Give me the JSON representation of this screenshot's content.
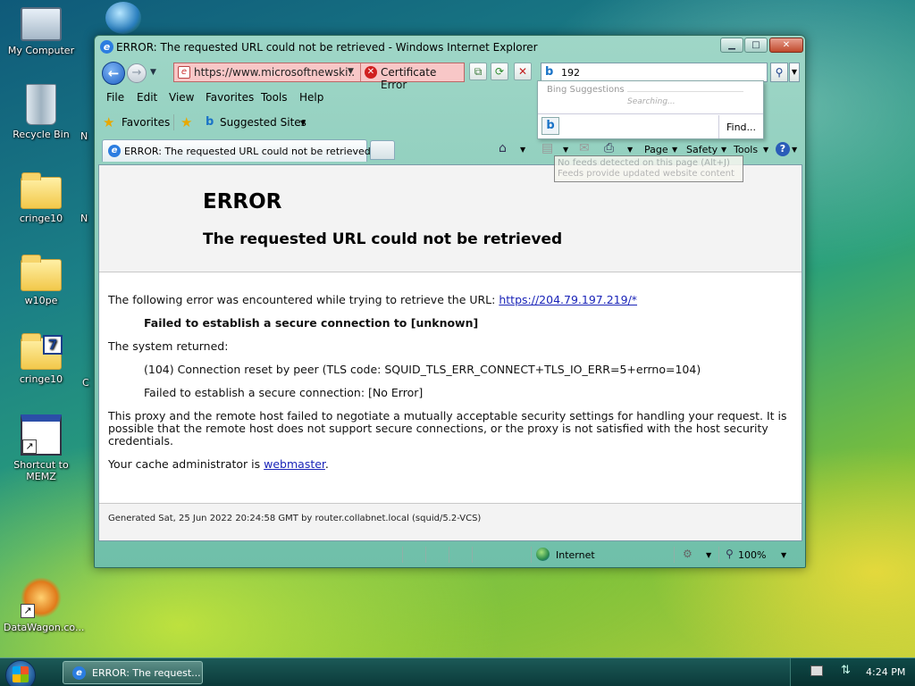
{
  "desktop": {
    "icons": [
      {
        "label": "My Computer"
      },
      {
        "label": "Recycle Bin"
      },
      {
        "label": "cringe10"
      },
      {
        "label": "w10pe"
      },
      {
        "label": "cringe10"
      },
      {
        "label": "Shortcut to MEMZ"
      },
      {
        "label": "DataWagon.co..."
      }
    ],
    "partial_labels": [
      "N",
      "N",
      "C"
    ]
  },
  "window": {
    "title": "ERROR: The requested URL could not be retrieved - Windows Internet Explorer",
    "address": "https://www.microsoftnewski...",
    "cert_error": "Certificate Error",
    "search_value": "192",
    "menu": [
      "File",
      "Edit",
      "View",
      "Favorites",
      "Tools",
      "Help"
    ],
    "favorites_label": "Favorites",
    "suggested_sites": "Suggested Sites",
    "tab_title": "ERROR: The requested URL could not be retrieved",
    "commands": {
      "page": "Page",
      "safety": "Safety",
      "tools": "Tools"
    },
    "status_zone": "Internet",
    "zoom": "100%"
  },
  "search_suggestions": {
    "header": "Bing Suggestions",
    "status": "Searching...",
    "find": "Find..."
  },
  "tooltip": {
    "line1": "No feeds detected on this page (Alt+J)",
    "line2": "Feeds provide updated website content"
  },
  "page": {
    "heading": "ERROR",
    "subheading": "The requested URL could not be retrieved",
    "intro": "The following error was encountered while trying to retrieve the URL:",
    "url": "https://204.79.197.219/*",
    "failed": "Failed to establish a secure connection to [unknown]",
    "system_returned": "The system returned:",
    "code_line": "(104) Connection reset by peer (TLS code: SQUID_TLS_ERR_CONNECT+TLS_IO_ERR=5+errno=104)",
    "no_error_line": "Failed to establish a secure connection: [No Error]",
    "para1": "This proxy and the remote host failed to negotiate a mutually acceptable security settings for handling your request. It is",
    "para2": "possible that the remote host does not support secure connections, or the proxy is not satisfied with the host security",
    "para3": "credentials.",
    "cache_admin": "Your cache administrator is",
    "webmaster": "webmaster",
    "period": ".",
    "footer": "Generated Sat, 25 Jun 2022 20:24:58 GMT by router.collabnet.local (squid/5.2-VCS)"
  },
  "taskbar": {
    "task_label": "ERROR: The request...",
    "clock": "4:24 PM"
  }
}
